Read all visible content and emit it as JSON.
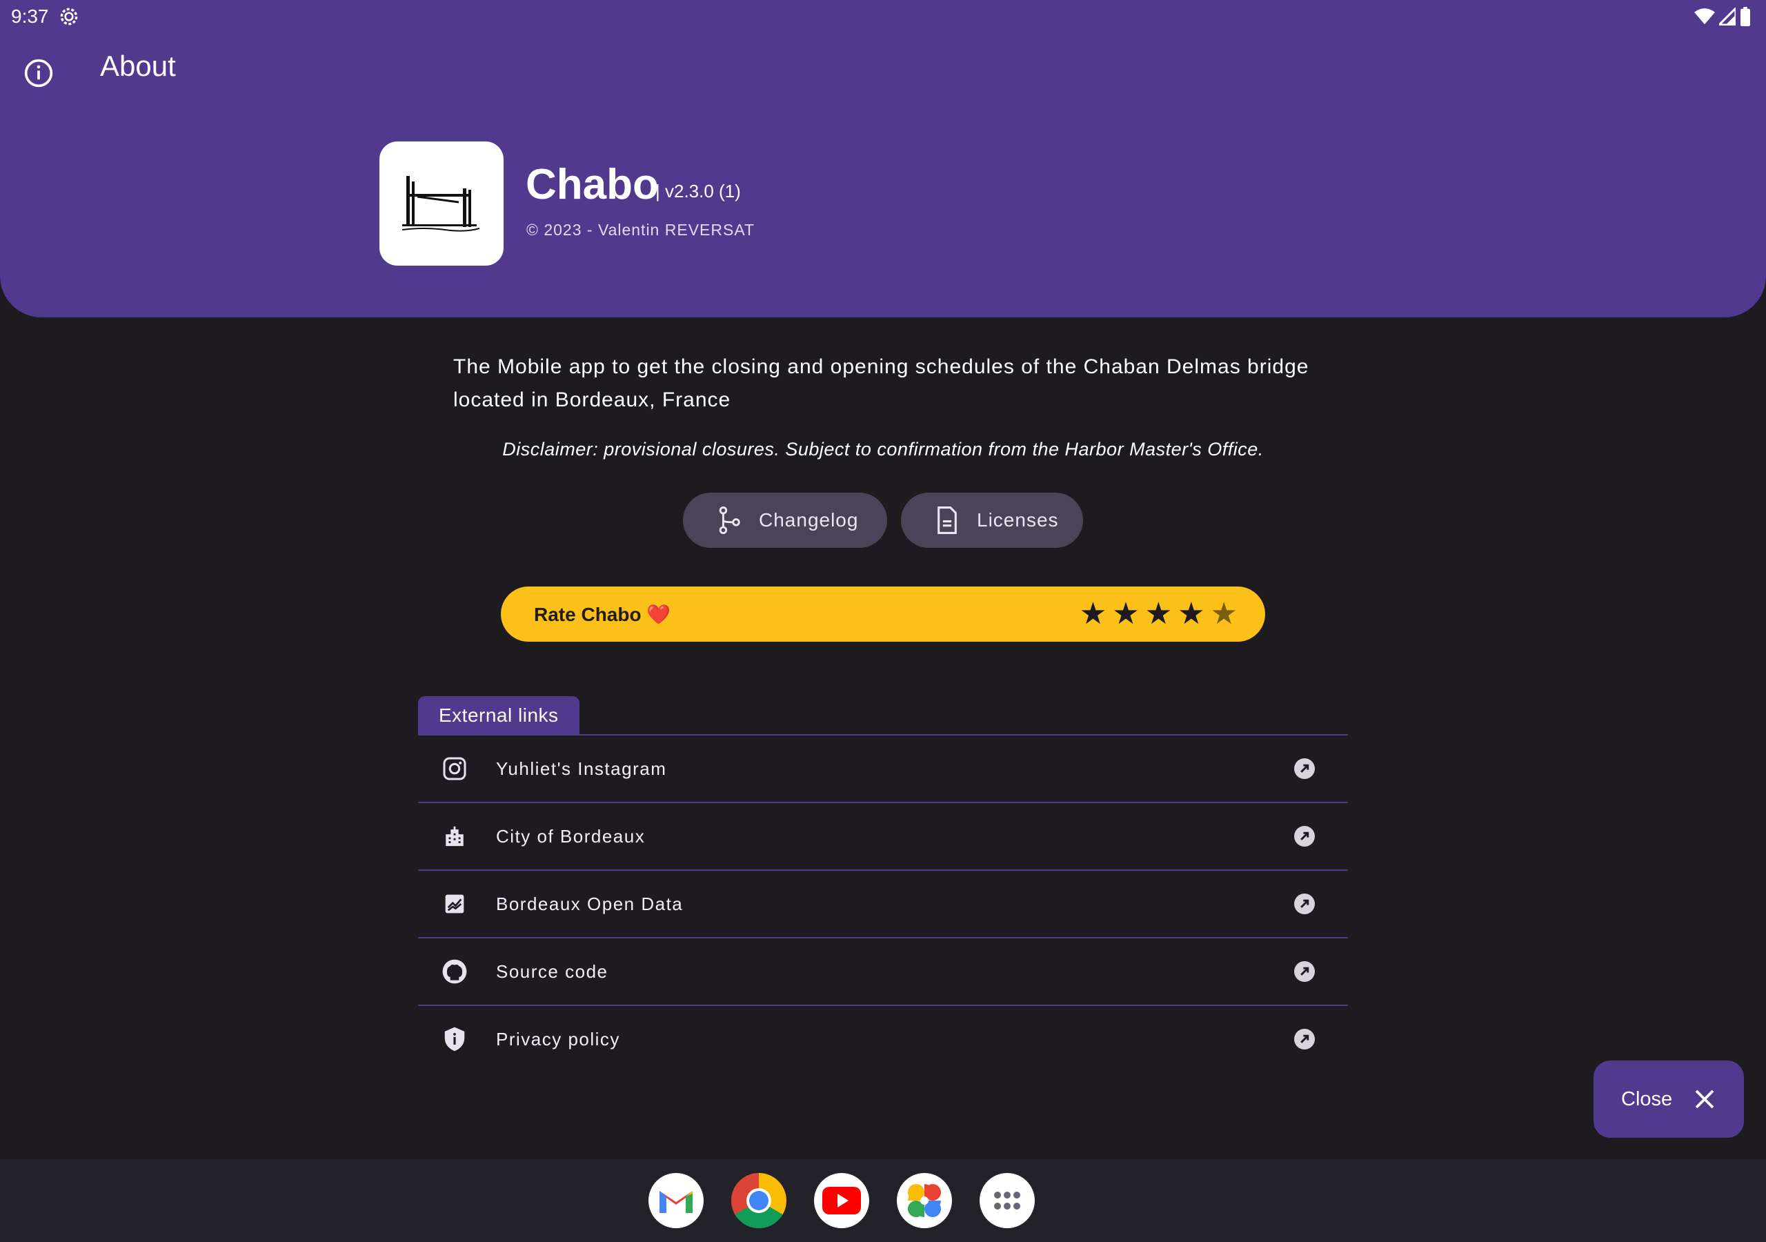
{
  "status_bar": {
    "time": "9:37"
  },
  "toolbar": {
    "title": "About"
  },
  "app": {
    "name": "Chabo",
    "version": "| v2.3.0 (1)",
    "copyright": "© 2023 - Valentin REVERSAT",
    "description": "The Mobile app to get the closing and opening schedules of the Chaban Delmas bridge located in Bordeaux, France",
    "disclaimer": "Disclaimer: provisional closures. Subject to confirmation from the Harbor Master's Office."
  },
  "actions": {
    "changelog_label": "Changelog",
    "licenses_label": "Licenses"
  },
  "rating": {
    "label": "Rate Chabo ❤️",
    "stars": 5,
    "filled": 4.5
  },
  "external_links": {
    "tab_label": "External links",
    "items": [
      {
        "label": "Yuhliet's Instagram",
        "icon": "instagram-icon"
      },
      {
        "label": "City of Bordeaux",
        "icon": "city-icon"
      },
      {
        "label": "Bordeaux Open Data",
        "icon": "chart-icon"
      },
      {
        "label": "Source code",
        "icon": "github-icon"
      },
      {
        "label": "Privacy policy",
        "icon": "shield-icon"
      }
    ]
  },
  "close_button": {
    "label": "Close"
  },
  "dock": {
    "apps": [
      "gmail-icon",
      "chrome-icon",
      "youtube-icon",
      "photos-icon",
      "app-drawer-icon"
    ]
  },
  "colors": {
    "primary": "#51398e",
    "background": "#1d1b20",
    "rating": "#fbc11a",
    "pill": "#4a4458"
  }
}
